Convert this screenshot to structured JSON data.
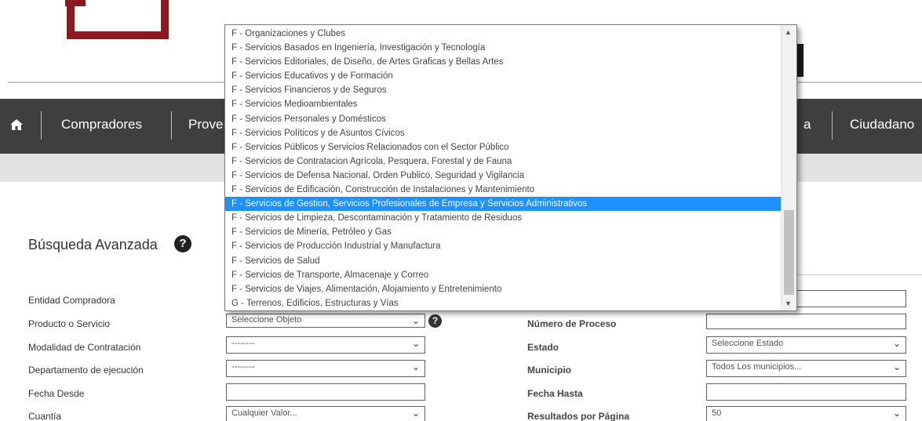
{
  "nav": {
    "items": [
      "Compradores",
      "Prove",
      "a",
      "Ciudadano"
    ]
  },
  "dropdown": {
    "options": [
      "F - Organizaciones y Clubes",
      "F - Servicios Basados en Ingeniería, Investigación y Tecnología",
      "F - Servicios Editoriales, de Diseño, de Artes Graficas y Bellas Artes",
      "F - Servicios Educativos y de Formación",
      "F - Servicios Financieros y de Seguros",
      "F - Servicios Medioambientales",
      "F - Servicios Personales y Domésticos",
      "F - Servicios Políticos y de Asuntos Cívicos",
      "F - Servicios Públicos y Servicios Relacionados con el Sector Público",
      "F - Servicios de Contratacion Agrícola, Pesquera, Forestal y de Fauna",
      "F - Servicios de Defensa Nacional, Orden Publico, Seguridad y Vigilancia",
      "F - Servicios de Edificación, Construcción de Instalaciones y Mantenimiento",
      "F - Servicios de Gestion, Servicios Profesionales de Empresa y Servicios Administrativos",
      "F - Servicios de Limpieza, Descontaminación y Tratamiento de Residuos",
      "F - Servicios de Minería, Petróleo y Gas",
      "F - Servicios de Producción Industrial y Manufactura",
      "F - Servicios de Salud",
      "F - Servicios de Transporte, Almacenaje y Correo",
      "F - Servicios de Viajes, Alimentación, Alojamiento y Entretenimiento",
      "G - Terrenos, Edificios, Estructuras y Vías"
    ],
    "selected_index": 12
  },
  "search": {
    "heading": "Búsqueda Avanzada",
    "labels_left": {
      "entidad": "Entidad Compradora",
      "producto": "Producto o Servicio",
      "modalidad": "Modalidad de Contratación",
      "departamento": "Departamento de ejecución",
      "fecha_desde": "Fecha Desde",
      "cuantia": "Cuantía"
    },
    "labels_right": {
      "numero_proceso": "Número de Proceso",
      "estado": "Estado",
      "municipio": "Municipio",
      "fecha_hasta": "Fecha Hasta",
      "resultados": "Resultados por Página"
    },
    "values": {
      "producto": "Seleccione Objeto",
      "modalidad": "--------",
      "departamento": "--------",
      "fecha_desde": "",
      "cuantia": "Cualquier Valor...",
      "numero_proceso": "",
      "estado": "Seleccione Estado",
      "municipio": "Todos Los municipios...",
      "fecha_hasta": "",
      "resultados": "50"
    }
  },
  "colors": {
    "nav_bg": "#3f3f40",
    "logo": "#8a1a1f",
    "selected_option": "#1e90ff"
  }
}
